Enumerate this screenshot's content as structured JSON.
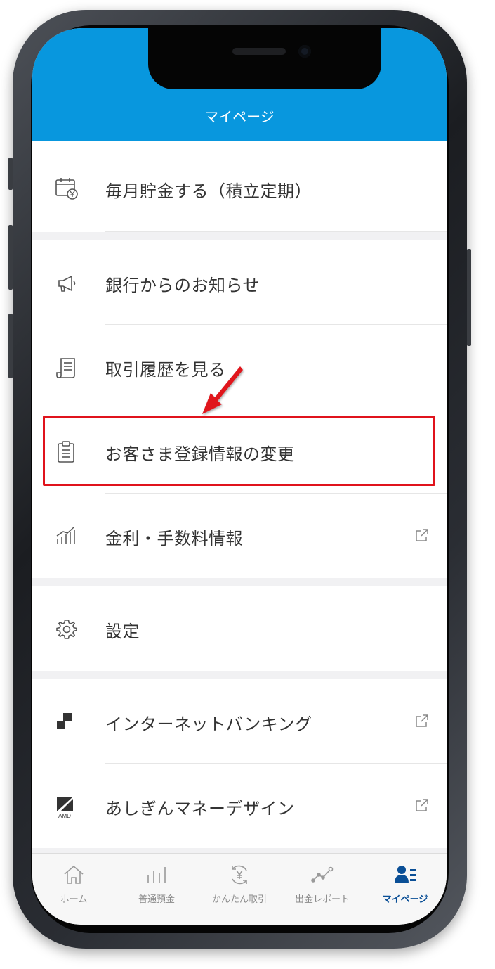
{
  "header": {
    "title": "マイページ"
  },
  "menu": [
    {
      "label": "毎月貯金する（積立定期）",
      "icon": "calendar-yen-icon",
      "external": false
    },
    {
      "label": "銀行からのお知らせ",
      "icon": "megaphone-icon",
      "external": false
    },
    {
      "label": "取引履歴を見る",
      "icon": "receipt-icon",
      "external": false
    },
    {
      "label": "お客さま登録情報の変更",
      "icon": "clipboard-icon",
      "external": false,
      "highlighted": true
    },
    {
      "label": "金利・手数料情報",
      "icon": "bar-chart-icon",
      "external": true
    },
    {
      "label": "設定",
      "icon": "gear-icon",
      "external": false
    },
    {
      "label": "インターネットバンキング",
      "icon": "blocks-icon",
      "external": true
    },
    {
      "label": "あしぎんマネーデザイン",
      "icon": "amd-logo-icon",
      "icon_text": "AMD",
      "external": true
    }
  ],
  "tabs": [
    {
      "label": "ホーム",
      "icon": "home-icon",
      "active": false
    },
    {
      "label": "普通預金",
      "icon": "bars-icon",
      "active": false
    },
    {
      "label": "かんたん取引",
      "icon": "yen-exchange-icon",
      "active": false
    },
    {
      "label": "出金レポート",
      "icon": "line-chart-icon",
      "active": false
    },
    {
      "label": "マイページ",
      "icon": "user-list-icon",
      "active": true
    }
  ],
  "colors": {
    "header": "#0897de",
    "highlight": "#e0131c",
    "active_tab": "#0a4f96"
  }
}
